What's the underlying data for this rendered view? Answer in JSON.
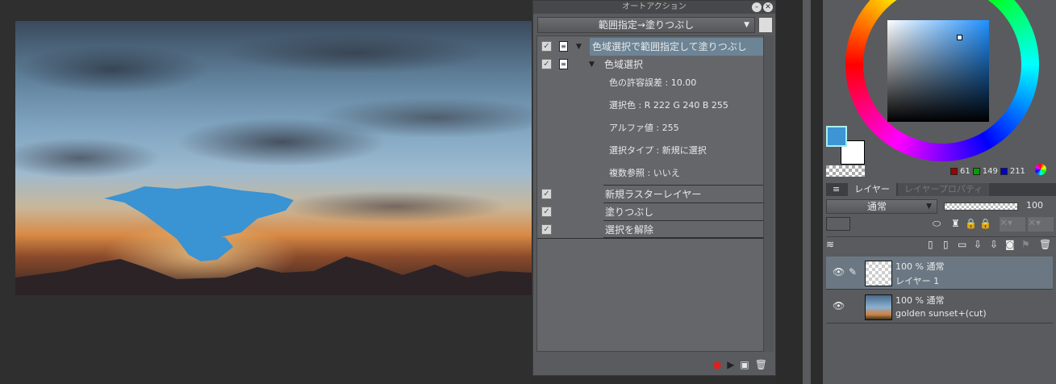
{
  "auto_action": {
    "title": "オートアクション",
    "set_name": "範囲指定→塗りつぶし",
    "items": [
      {
        "label": "色域選択で範囲指定して塗りつぶし",
        "checked": true
      },
      {
        "label": "色域選択",
        "checked": true
      },
      {
        "label": "色の許容誤差 : 10.00"
      },
      {
        "label": "選択色 : R 222 G 240 B 255"
      },
      {
        "label": "アルファ値 : 255"
      },
      {
        "label": "選択タイプ : 新規に選択"
      },
      {
        "label": "複数参照 : いいえ"
      },
      {
        "label": "新規ラスターレイヤー",
        "checked": true
      },
      {
        "label": "塗りつぶし",
        "checked": true
      },
      {
        "label": "選択を解除",
        "checked": true
      }
    ]
  },
  "color": {
    "r": "61",
    "g": "149",
    "b": "211",
    "main": "#3d95d3",
    "sub": "#ffffff"
  },
  "layer_panel": {
    "tabs": [
      "レイヤー",
      "レイヤープロパティ"
    ],
    "blend_mode": "通常",
    "opacity": "100",
    "layers": [
      {
        "mode": "100 % 通常",
        "name": "レイヤー 1",
        "selected": true
      },
      {
        "mode": "100 % 通常",
        "name": "golden sunset+(cut)",
        "selected": false
      }
    ]
  }
}
